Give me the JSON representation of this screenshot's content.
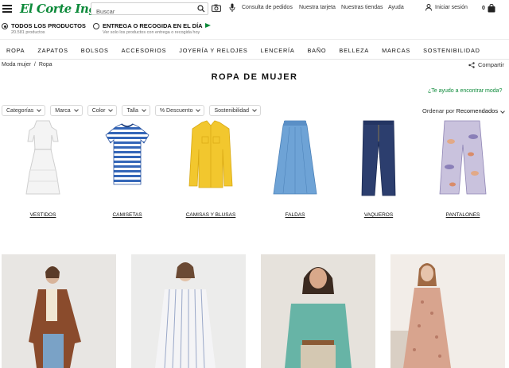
{
  "header": {
    "logo": "El Corte Inglés",
    "search_placeholder": "Buscar",
    "links": [
      "Consulta de pedidos",
      "Nuestra tarjeta",
      "Nuestras tiendas",
      "Ayuda"
    ],
    "login": "Iniciar sesión",
    "cart_count": "0"
  },
  "delivery": {
    "all_products": {
      "title": "TODOS LOS PRODUCTOS",
      "sub": "20.581 productos",
      "selected": true
    },
    "same_day": {
      "title": "ENTREGA O RECOGIDA EN EL DÍA",
      "sub": "Ver solo los productos con entrega o recogida hoy",
      "selected": false
    }
  },
  "categories": [
    "ROPA",
    "ZAPATOS",
    "BOLSOS",
    "ACCESORIOS",
    "JOYERÍA Y RELOJES",
    "LENCERÍA",
    "BAÑO",
    "BELLEZA",
    "MARCAS",
    "SOSTENIBILIDAD"
  ],
  "breadcrumb": {
    "first": "Moda mujer",
    "sep": "/",
    "second": "Ropa"
  },
  "share_label": "Compartir",
  "page_title": "ROPA DE MUJER",
  "help_link": "¿Te ayudo a encontrar moda?",
  "filters": [
    "Categorías",
    "Marca",
    "Color",
    "Talla",
    "% Descuento",
    "Sostenibilidad"
  ],
  "sort": {
    "label": "Ordenar por",
    "value": "Recomendados"
  },
  "subcategories": [
    "VESTIDOS",
    "CAMISETAS",
    "CAMISAS Y BLUSAS",
    "FALDAS",
    "VAQUEROS",
    "PANTALONES"
  ],
  "colors": {
    "brand_green": "#0d8a3a",
    "text": "#222222"
  }
}
